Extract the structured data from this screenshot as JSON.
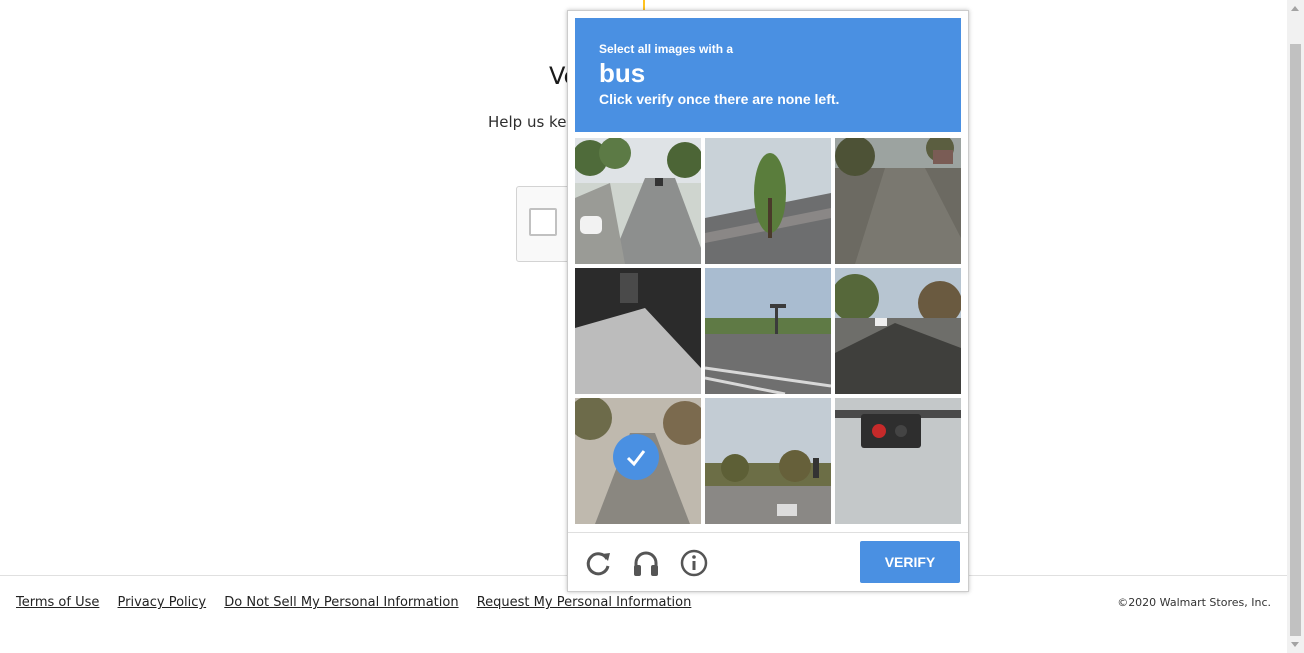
{
  "background_page": {
    "title_fragment": "Ve",
    "subtitle_fragment": "Help us kee"
  },
  "challenge": {
    "prompt_small": "Select all images with a",
    "prompt_target": "bus",
    "prompt_instruction": "Click verify once there are none left.",
    "tiles": [
      {
        "scene": "road-with-cars",
        "selected": false
      },
      {
        "scene": "tree-roof",
        "selected": false
      },
      {
        "scene": "dark-road",
        "selected": false
      },
      {
        "scene": "dark-shadow",
        "selected": false
      },
      {
        "scene": "intersection",
        "selected": false
      },
      {
        "scene": "residential-street",
        "selected": false
      },
      {
        "scene": "street-traffic",
        "selected": true
      },
      {
        "scene": "road-trees",
        "selected": false
      },
      {
        "scene": "traffic-light-closeup",
        "selected": false
      }
    ],
    "reload_icon": "reload-icon",
    "audio_icon": "headphones-icon",
    "info_icon": "info-icon",
    "verify_label": "VERIFY",
    "accent_color": "#4a90e2"
  },
  "footer": {
    "links": [
      "Terms of Use",
      "Privacy Policy",
      "Do Not Sell My Personal Information",
      "Request My Personal Information"
    ],
    "copyright": "©2020 Walmart Stores, Inc."
  }
}
